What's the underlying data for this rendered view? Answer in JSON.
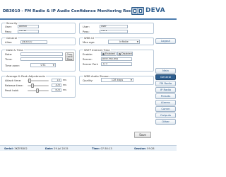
{
  "header": {
    "title": "DB3010 - FM Radio & IP Audio Confidence Monitoring Receiver",
    "logo_text": "DEVA"
  },
  "security": {
    "legend": "Security",
    "user_label": "User:",
    "user_value": "admin",
    "pass_label": "Pass:",
    "pass_value": "•••••"
  },
  "security_user": {
    "user_label": "User:",
    "user_value": "user",
    "pass_label": "Pass:",
    "pass_value": "••••"
  },
  "general": {
    "legend": "General",
    "alias_label": "Alias:",
    "alias_value": "DB3010"
  },
  "web_ui": {
    "legend": "WEB UI",
    "max_age_label": "Max age:",
    "max_age_value": "Infinite"
  },
  "date_time": {
    "legend": "Date & Time",
    "date_label": "Date:",
    "time_label": "Time:",
    "copy_button": "Copy Local Time",
    "tz_label": "Time zone:",
    "tz_value": "UTC"
  },
  "sntp": {
    "legend": "SNTP Internet Time",
    "enable_label": "Enable:",
    "enabled_option": "Enabled",
    "disabled_option": "Disabled",
    "selected": "Enabled",
    "server_label": "Server:",
    "server_value": "pool.ntp.org",
    "port_label": "Server Port:",
    "port_value": "123"
  },
  "peak": {
    "legend": "Average & Peak Adjustments",
    "attack_label": "Attack time:",
    "attack_value": "10",
    "attack_unit": "ms",
    "release_label": "Release time:",
    "release_value": "100",
    "release_unit": "ms",
    "hold_label": "Peak hold:",
    "hold_value": "500",
    "hold_unit": "ms"
  },
  "audio_stream": {
    "legend": "WEB Audio Stream",
    "quality_label": "Quality:",
    "quality_value": "128 kbps"
  },
  "actions": {
    "save_label": "Save"
  },
  "sidebar": {
    "logout": "Logout",
    "items": [
      {
        "label": "Main"
      },
      {
        "label": "General"
      },
      {
        "label": "FM Radio"
      },
      {
        "label": "IP Radio"
      },
      {
        "label": "Presets"
      },
      {
        "label": "Alarms"
      },
      {
        "label": "Comm"
      },
      {
        "label": "Outputs"
      },
      {
        "label": "Other"
      }
    ],
    "active": "General"
  },
  "footer": {
    "serial_label": "Serial:",
    "serial_value": "3KZF8302",
    "date_label": "Date:",
    "date_value": "29 Jul 2015",
    "time_label": "Time:",
    "time_value": "07:30:13",
    "session_label": "Session:",
    "session_value": "59:28"
  },
  "colors": {
    "brand": "#2e5e8f",
    "title": "#1a3f6b",
    "panel_border": "#b9c9d9"
  }
}
